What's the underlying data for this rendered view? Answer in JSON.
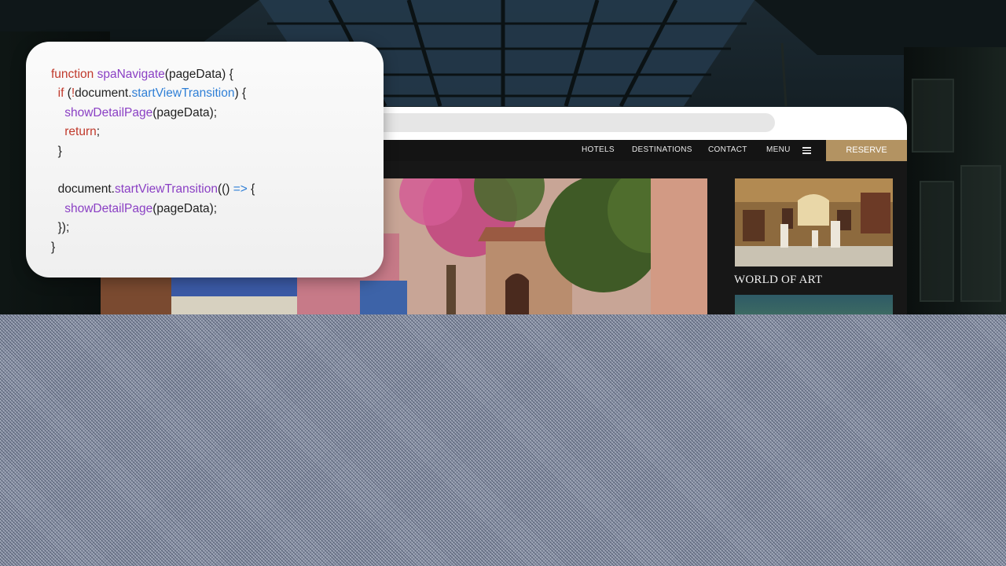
{
  "code_card": {
    "lines": [
      [
        {
          "t": "function ",
          "c": "kw"
        },
        {
          "t": "spaNavigate",
          "c": "fn"
        },
        {
          "t": "(pageData) {",
          "c": "plain"
        }
      ],
      [
        {
          "t": "  ",
          "c": "plain"
        },
        {
          "t": "if",
          "c": "kw"
        },
        {
          "t": " (",
          "c": "plain"
        },
        {
          "t": "!",
          "c": "kw"
        },
        {
          "t": "document.",
          "c": "plain"
        },
        {
          "t": "startViewTransition",
          "c": "prop"
        },
        {
          "t": ") {",
          "c": "plain"
        }
      ],
      [
        {
          "t": "    ",
          "c": "plain"
        },
        {
          "t": "showDetailPage",
          "c": "fn"
        },
        {
          "t": "(pageData);",
          "c": "plain"
        }
      ],
      [
        {
          "t": "    ",
          "c": "plain"
        },
        {
          "t": "return",
          "c": "kw"
        },
        {
          "t": ";",
          "c": "plain"
        }
      ],
      [
        {
          "t": "  }",
          "c": "plain"
        }
      ],
      [
        {
          "t": "",
          "c": "plain"
        }
      ],
      [
        {
          "t": "  document.",
          "c": "plain"
        },
        {
          "t": "startViewTransition",
          "c": "fn"
        },
        {
          "t": "(() ",
          "c": "plain"
        },
        {
          "t": "=>",
          "c": "prop"
        },
        {
          "t": " {",
          "c": "plain"
        }
      ],
      [
        {
          "t": "    ",
          "c": "plain"
        },
        {
          "t": "showDetailPage",
          "c": "fn"
        },
        {
          "t": "(pageData);",
          "c": "plain"
        }
      ],
      [
        {
          "t": "  });",
          "c": "plain"
        }
      ],
      [
        {
          "t": "}",
          "c": "plain"
        }
      ]
    ]
  },
  "colors": {
    "keyword": "#c0392b",
    "function": "#8a3fc4",
    "property": "#2f7fd6",
    "reserve_button": "#b39362",
    "site_nav_background": "#141414"
  },
  "site": {
    "nav": {
      "hotels": "HOTELS",
      "destinations": "DESTINATIONS",
      "contact": "CONTACT",
      "menu": "MENU",
      "menu_icon": "hamburger-icon",
      "reserve": "RESERVE"
    },
    "sidebar": {
      "card_title": "WORLD OF ART"
    }
  }
}
